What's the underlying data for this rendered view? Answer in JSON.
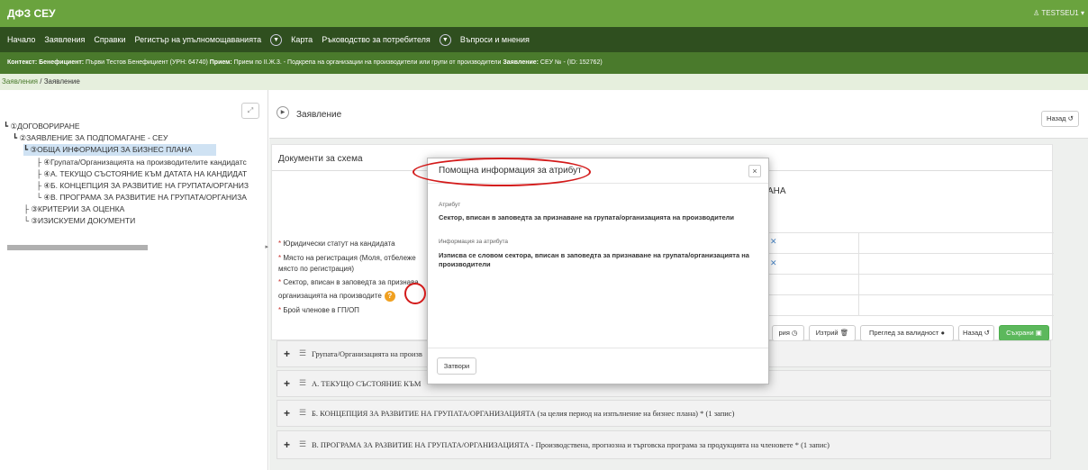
{
  "app": {
    "brand": "ДФЗ СЕУ",
    "user": "TESTSEU1"
  },
  "menu": {
    "home": "Начало",
    "applications": "Заявления",
    "reports": "Справки",
    "register": "Регистър на упълномощаванията",
    "map": "Карта",
    "manual": "Ръководство за потребителя",
    "faq": "Въпроси и мнения"
  },
  "context": {
    "k1": "Контекст:",
    "k2": "Бенефициент:",
    "v2": "Първи Тестов Бенефициент (УРН: 64740)",
    "k3": "Прием:",
    "v3": "Прием по II.Ж.3. - Подкрепа на организации на производители или групи от производители",
    "k4": "Заявление:",
    "v4": "СЕУ № - (ID: 152762)"
  },
  "breadcrumb": {
    "root": "Заявления",
    "sep": " / ",
    "current": "Заявление"
  },
  "tree": [
    {
      "label": "①ДОГОВОРИРАНЕ"
    },
    {
      "label": "②ЗАЯВЛЕНИЕ ЗА ПОДПОМАГАНЕ - СЕУ"
    },
    {
      "label": "③ОБЩА ИНФОРМАЦИЯ ЗА БИЗНЕС ПЛАНА"
    },
    {
      "label": "④Групата/Организацията на производителите кандидатс"
    },
    {
      "label": "④А. ТЕКУЩО СЪСТОЯНИЕ КЪМ ДАТАТА НА КАНДИДАТ"
    },
    {
      "label": "④Б. КОНЦЕПЦИЯ ЗА РАЗВИТИЕ НА ГРУПАТА/ОРГАНИЗ"
    },
    {
      "label": "④В. ПРОГРАМА ЗА РАЗВИТИЕ НА ГРУПАТА/ОРГАНИЗА"
    },
    {
      "label": "③КРИТЕРИИ ЗА ОЦЕНКА"
    },
    {
      "label": "③ИЗИСКУЕМИ ДОКУМЕНТИ"
    }
  ],
  "main": {
    "title": "Заявление",
    "back_label": "Назад",
    "docs_title": "Документи за схема",
    "heading_fragment": "АНА"
  },
  "fields": {
    "f1": "Юридически статут на кандидата",
    "f2a": "Място на регистрация (Моля, отбележе",
    "f2b": "място по регистрация)",
    "f3a": "Сектор, вписан в заповедта за признава",
    "f3b": "организацията на производите",
    "f4": "Брой членове в ГП/ОП",
    "req": "*"
  },
  "actions": {
    "history": "рия",
    "delete": "Изтрий",
    "validate": "Преглед за валидност",
    "back": "Назад",
    "save": "Съхрани"
  },
  "sections": [
    {
      "label": "Групата/Организацията на произв"
    },
    {
      "label": "А. ТЕКУЩО СЪСТОЯНИЕ КЪМ"
    },
    {
      "label": "Б. КОНЦЕПЦИЯ ЗА РАЗВИТИЕ НА ГРУПАТА/ОРГАНИЗАЦИЯТА (за целия период на изпълнение на бизнес плана) * (1 запис)"
    },
    {
      "label": "В. ПРОГРАМА ЗА РАЗВИТИЕ НА ГРУПАТА/ОРГАНИЗАЦИЯТА - Производствена, прогнозна и търговска програма за продукцията на членовете * (1 запис)"
    }
  ],
  "modal": {
    "title": "Помощна информация за атрибут",
    "attr_label": "Атрибут",
    "attr_value": "Сектор, вписан в заповедта за признаване на групата/организацията на производители",
    "info_label": "Информация за атрибута",
    "info_value": "Изписва се словом сектора, вписан в заповедта за признаване на групата/организацията на производители",
    "close_label": "Затвори"
  },
  "colors": {
    "brand_green": "#6aa33e",
    "menu_dark": "#2f4f1f",
    "context_green": "#4a7a2c",
    "save_green": "#5cb85c",
    "highlight_red": "#d31a1a"
  }
}
